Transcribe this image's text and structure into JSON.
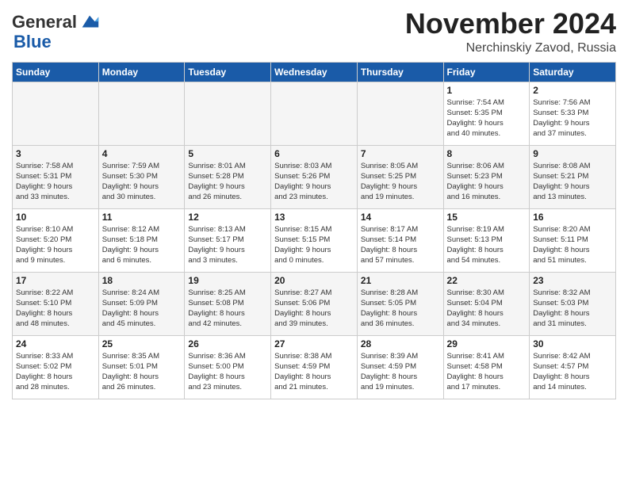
{
  "header": {
    "logo_general": "General",
    "logo_blue": "Blue",
    "month": "November 2024",
    "location": "Nerchinskiy Zavod, Russia"
  },
  "weekdays": [
    "Sunday",
    "Monday",
    "Tuesday",
    "Wednesday",
    "Thursday",
    "Friday",
    "Saturday"
  ],
  "weeks": [
    [
      {
        "day": "",
        "info": ""
      },
      {
        "day": "",
        "info": ""
      },
      {
        "day": "",
        "info": ""
      },
      {
        "day": "",
        "info": ""
      },
      {
        "day": "",
        "info": ""
      },
      {
        "day": "1",
        "info": "Sunrise: 7:54 AM\nSunset: 5:35 PM\nDaylight: 9 hours\nand 40 minutes."
      },
      {
        "day": "2",
        "info": "Sunrise: 7:56 AM\nSunset: 5:33 PM\nDaylight: 9 hours\nand 37 minutes."
      }
    ],
    [
      {
        "day": "3",
        "info": "Sunrise: 7:58 AM\nSunset: 5:31 PM\nDaylight: 9 hours\nand 33 minutes."
      },
      {
        "day": "4",
        "info": "Sunrise: 7:59 AM\nSunset: 5:30 PM\nDaylight: 9 hours\nand 30 minutes."
      },
      {
        "day": "5",
        "info": "Sunrise: 8:01 AM\nSunset: 5:28 PM\nDaylight: 9 hours\nand 26 minutes."
      },
      {
        "day": "6",
        "info": "Sunrise: 8:03 AM\nSunset: 5:26 PM\nDaylight: 9 hours\nand 23 minutes."
      },
      {
        "day": "7",
        "info": "Sunrise: 8:05 AM\nSunset: 5:25 PM\nDaylight: 9 hours\nand 19 minutes."
      },
      {
        "day": "8",
        "info": "Sunrise: 8:06 AM\nSunset: 5:23 PM\nDaylight: 9 hours\nand 16 minutes."
      },
      {
        "day": "9",
        "info": "Sunrise: 8:08 AM\nSunset: 5:21 PM\nDaylight: 9 hours\nand 13 minutes."
      }
    ],
    [
      {
        "day": "10",
        "info": "Sunrise: 8:10 AM\nSunset: 5:20 PM\nDaylight: 9 hours\nand 9 minutes."
      },
      {
        "day": "11",
        "info": "Sunrise: 8:12 AM\nSunset: 5:18 PM\nDaylight: 9 hours\nand 6 minutes."
      },
      {
        "day": "12",
        "info": "Sunrise: 8:13 AM\nSunset: 5:17 PM\nDaylight: 9 hours\nand 3 minutes."
      },
      {
        "day": "13",
        "info": "Sunrise: 8:15 AM\nSunset: 5:15 PM\nDaylight: 9 hours\nand 0 minutes."
      },
      {
        "day": "14",
        "info": "Sunrise: 8:17 AM\nSunset: 5:14 PM\nDaylight: 8 hours\nand 57 minutes."
      },
      {
        "day": "15",
        "info": "Sunrise: 8:19 AM\nSunset: 5:13 PM\nDaylight: 8 hours\nand 54 minutes."
      },
      {
        "day": "16",
        "info": "Sunrise: 8:20 AM\nSunset: 5:11 PM\nDaylight: 8 hours\nand 51 minutes."
      }
    ],
    [
      {
        "day": "17",
        "info": "Sunrise: 8:22 AM\nSunset: 5:10 PM\nDaylight: 8 hours\nand 48 minutes."
      },
      {
        "day": "18",
        "info": "Sunrise: 8:24 AM\nSunset: 5:09 PM\nDaylight: 8 hours\nand 45 minutes."
      },
      {
        "day": "19",
        "info": "Sunrise: 8:25 AM\nSunset: 5:08 PM\nDaylight: 8 hours\nand 42 minutes."
      },
      {
        "day": "20",
        "info": "Sunrise: 8:27 AM\nSunset: 5:06 PM\nDaylight: 8 hours\nand 39 minutes."
      },
      {
        "day": "21",
        "info": "Sunrise: 8:28 AM\nSunset: 5:05 PM\nDaylight: 8 hours\nand 36 minutes."
      },
      {
        "day": "22",
        "info": "Sunrise: 8:30 AM\nSunset: 5:04 PM\nDaylight: 8 hours\nand 34 minutes."
      },
      {
        "day": "23",
        "info": "Sunrise: 8:32 AM\nSunset: 5:03 PM\nDaylight: 8 hours\nand 31 minutes."
      }
    ],
    [
      {
        "day": "24",
        "info": "Sunrise: 8:33 AM\nSunset: 5:02 PM\nDaylight: 8 hours\nand 28 minutes."
      },
      {
        "day": "25",
        "info": "Sunrise: 8:35 AM\nSunset: 5:01 PM\nDaylight: 8 hours\nand 26 minutes."
      },
      {
        "day": "26",
        "info": "Sunrise: 8:36 AM\nSunset: 5:00 PM\nDaylight: 8 hours\nand 23 minutes."
      },
      {
        "day": "27",
        "info": "Sunrise: 8:38 AM\nSunset: 4:59 PM\nDaylight: 8 hours\nand 21 minutes."
      },
      {
        "day": "28",
        "info": "Sunrise: 8:39 AM\nSunset: 4:59 PM\nDaylight: 8 hours\nand 19 minutes."
      },
      {
        "day": "29",
        "info": "Sunrise: 8:41 AM\nSunset: 4:58 PM\nDaylight: 8 hours\nand 17 minutes."
      },
      {
        "day": "30",
        "info": "Sunrise: 8:42 AM\nSunset: 4:57 PM\nDaylight: 8 hours\nand 14 minutes."
      }
    ]
  ]
}
